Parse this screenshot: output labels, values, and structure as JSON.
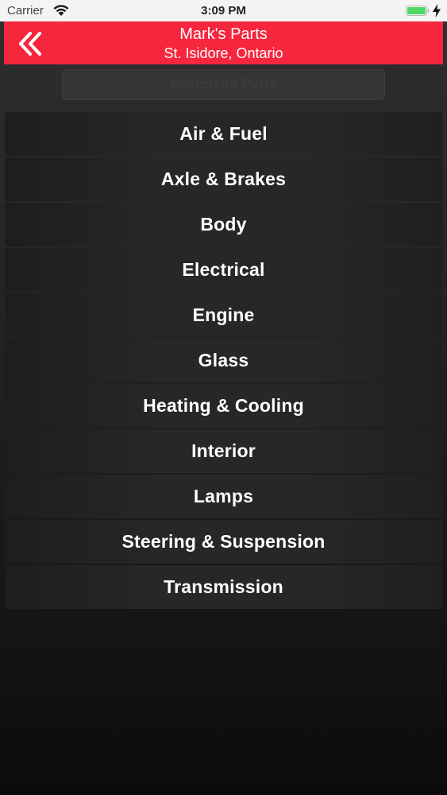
{
  "status_bar": {
    "carrier": "Carrier",
    "time": "3:09 PM",
    "icons": [
      "wifi-icon",
      "battery-icon",
      "charging-bolt-icon"
    ],
    "battery_color": "#4cd964"
  },
  "nav": {
    "title": "Mark's Parts",
    "subtitle": "St. Isidore, Ontario",
    "back_icon": "double-chevron-left-icon",
    "background_color": "#f5263d"
  },
  "search": {
    "placeholder": "Search all Parts",
    "value": ""
  },
  "categories": [
    {
      "label": "Air & Fuel"
    },
    {
      "label": "Axle & Brakes"
    },
    {
      "label": "Body"
    },
    {
      "label": "Electrical"
    },
    {
      "label": "Engine"
    },
    {
      "label": "Glass"
    },
    {
      "label": "Heating & Cooling"
    },
    {
      "label": "Interior"
    },
    {
      "label": "Lamps"
    },
    {
      "label": "Steering & Suspension"
    },
    {
      "label": "Transmission"
    }
  ]
}
